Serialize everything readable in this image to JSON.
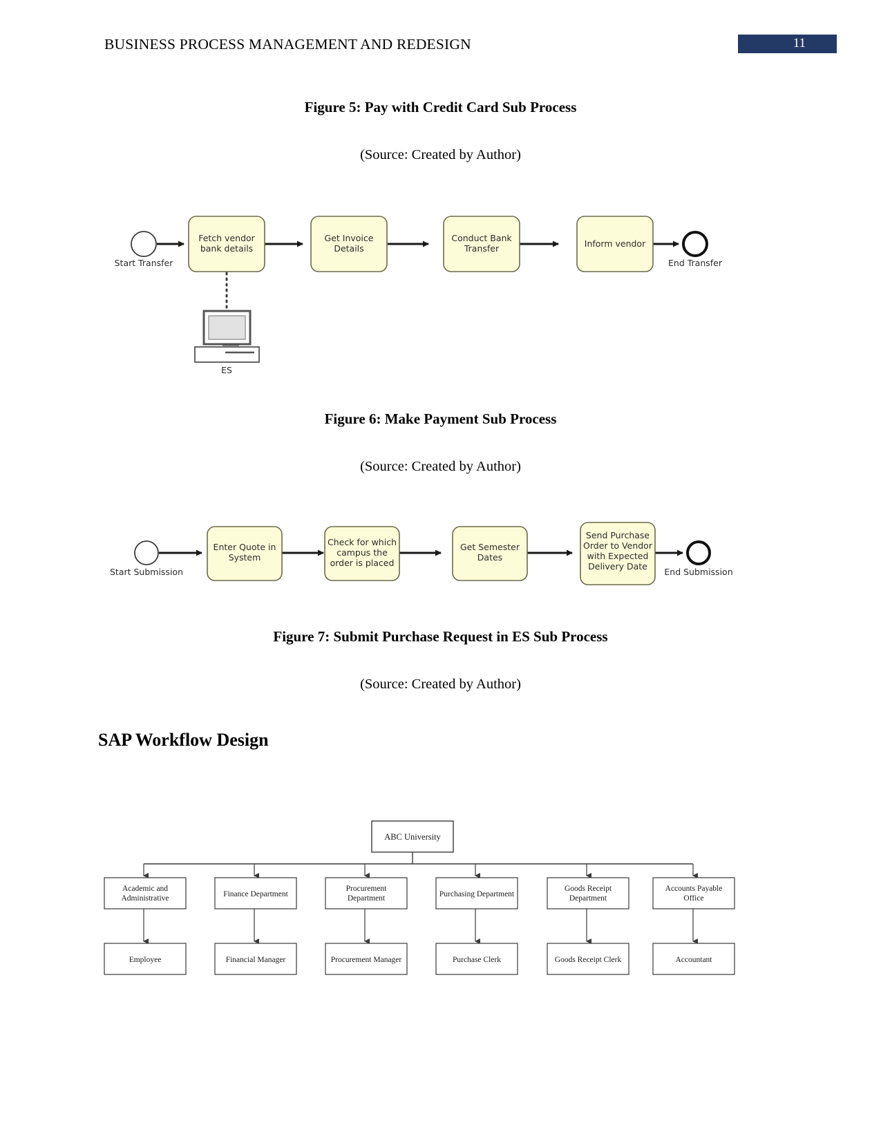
{
  "header": {
    "title": "BUSINESS PROCESS MANAGEMENT AND REDESIGN",
    "page_number": "11",
    "badge_color": "#243a66"
  },
  "captions": {
    "figure5": "Figure 5: Pay with Credit Card Sub Process",
    "figure5_source": "(Source: Created by Author)",
    "figure6": "Figure 6: Make Payment Sub Process",
    "figure6_source": "(Source: Created by Author)",
    "figure7": "Figure 7: Submit Purchase Request in ES Sub Process",
    "figure7_source": "(Source: Created by Author)"
  },
  "section": {
    "heading": "SAP Workflow Design"
  },
  "diagram_payment": {
    "start_label": "Start Transfer",
    "end_label": "End Transfer",
    "tasks": [
      {
        "line1": "Fetch vendor",
        "line2": "bank details"
      },
      {
        "line1": "Get Invoice",
        "line2": "Details"
      },
      {
        "line1": "Conduct Bank",
        "line2": "Transfer"
      },
      {
        "line1": "Inform vendor",
        "line2": ""
      }
    ],
    "datastore_label": "ES",
    "task_fill": "#fdfcd8",
    "task_stroke": "#6b6b4e"
  },
  "diagram_submission": {
    "start_label": "Start Submission",
    "end_label": "End Submission",
    "tasks": [
      {
        "line1": "Enter Quote in",
        "line2": "System",
        "line3": "",
        "line4": ""
      },
      {
        "line1": "Check for which",
        "line2": "campus the",
        "line3": "order is placed",
        "line4": ""
      },
      {
        "line1": "Get Semester",
        "line2": "Dates",
        "line3": "",
        "line4": ""
      },
      {
        "line1": "Send Purchase",
        "line2": "Order to Vendor",
        "line3": "with Expected",
        "line4": "Delivery Date"
      }
    ],
    "task_fill": "#fdfcd8",
    "task_stroke": "#6b6b4e"
  },
  "org_chart": {
    "root": "ABC University",
    "departments": [
      {
        "line1": "Academic and",
        "line2": "Administrative"
      },
      {
        "line1": "Finance Department",
        "line2": ""
      },
      {
        "line1": "Procurement",
        "line2": "Department"
      },
      {
        "line1": "Purchasing Department",
        "line2": ""
      },
      {
        "line1": "Goods Receipt",
        "line2": "Department"
      },
      {
        "line1": "Accounts Payable",
        "line2": "Office"
      }
    ],
    "roles": [
      "Employee",
      "Financial Manager",
      "Procurement  Manager",
      "Purchase Clerk",
      "Goods Receipt Clerk",
      "Accountant"
    ]
  }
}
